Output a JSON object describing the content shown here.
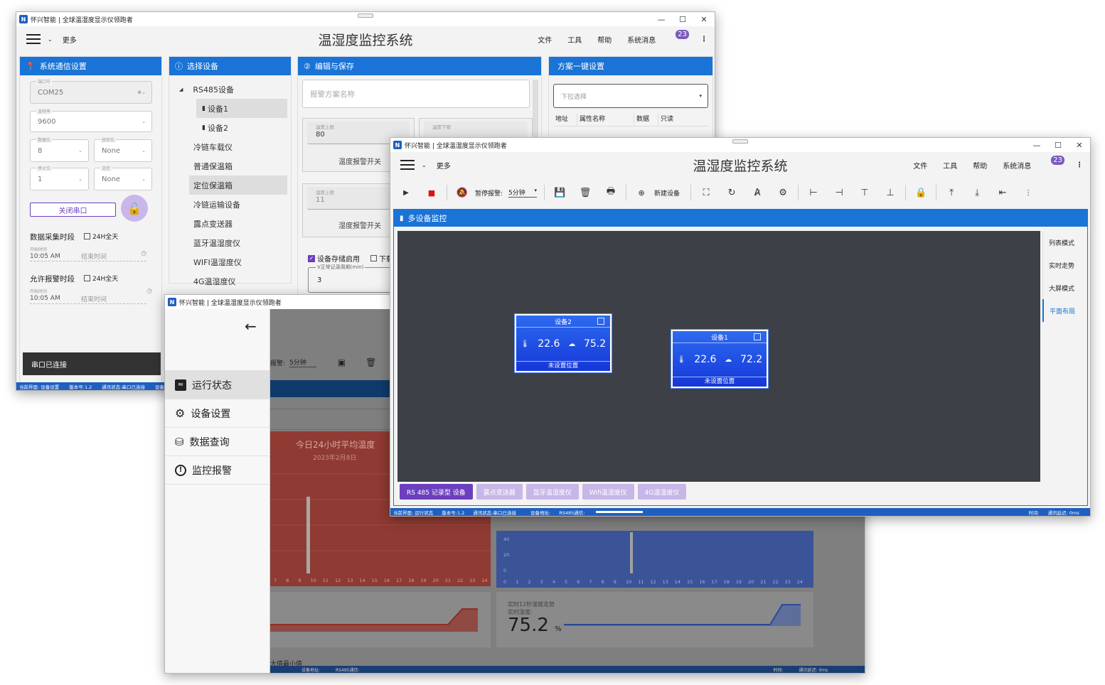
{
  "app": {
    "window_title": "怀兴智能 | 全球温湿度显示仪领跑者",
    "app_title": "温湿度监控系统",
    "logo_letter": "N",
    "more": "更多",
    "menus": {
      "file": "文件",
      "tools": "工具",
      "help": "帮助",
      "messages": "系统消息",
      "badge": "23"
    },
    "colors": {
      "accent": "#1a73d6",
      "statusbar": "#1f5fbf",
      "purple": "#6c3fbf"
    }
  },
  "win1": {
    "comm": {
      "header": "系统通信设置",
      "port_label": "端口号",
      "port_value": "COM25",
      "baud_label": "波特率",
      "baud_value": "9600",
      "databits_label": "数据位",
      "databits_value": "8",
      "parity_label": "校验位",
      "parity_value": "None",
      "stopbits_label": "停止位",
      "stopbits_value": "1",
      "flow_label": "流控",
      "flow_value": "None",
      "close_port": "关闭串口",
      "collect_period": "数据采集时段",
      "all_day": "24H全天",
      "start_label": "开始时间",
      "start_value": "10:05 AM",
      "end_placeholder": "结束时间",
      "alarm_period": "允许报警时段",
      "alarm_start_value": "10:05 AM",
      "toast": "串口已连接"
    },
    "select": {
      "header": "选择设备",
      "group": "RS485设备",
      "items": [
        "设备1",
        "设备2",
        "冷链车载仪",
        "普通保温箱",
        "定位保温箱",
        "冷链运输设备",
        "露点变送器",
        "蓝牙温湿度仪",
        "WIFI温湿度仪",
        "4G温湿度仪"
      ]
    },
    "edit": {
      "header": "编辑与保存",
      "scheme_placeholder": "报警方案名称",
      "temp_upper_label": "温度上限",
      "temp_upper_value": "80",
      "temp_lower_label": "温度下限",
      "temp_switch": "温度报警开关",
      "hum_upper_label": "湿度上限",
      "hum_upper_value": "11",
      "hum_switch": "湿度报警开关",
      "storage_enable": "设备存储启用",
      "download": "下载",
      "record_period_label": "V正常记录周期(min)",
      "record_period_value": "3"
    },
    "scheme": {
      "header": "方案一键设置",
      "dropdown": "下拉选择",
      "cols": [
        "地址",
        "属性名称",
        "数据",
        "只读"
      ]
    },
    "status": [
      "当前界面: 设备设置",
      "版本号:1.2",
      "通讯状态:串口已连接",
      "设备"
    ]
  },
  "win2": {
    "nav": [
      {
        "label": "运行状态",
        "icon": "wave-icon"
      },
      {
        "label": "设备设置",
        "icon": "gear-icon"
      },
      {
        "label": "数据查询",
        "icon": "db-search-icon"
      },
      {
        "label": "监控报警",
        "icon": "alert-icon"
      }
    ],
    "bg": {
      "pause_alarm_short": "报警:",
      "interval": "5分钟",
      "chart_title": "今日24小时平均温度",
      "chart_date": "2023年2月8日",
      "x_ticks_left": [
        "7",
        "8",
        "9",
        "10",
        "11",
        "12",
        "13",
        "14",
        "15",
        "16",
        "17",
        "18",
        "19",
        "20",
        "21",
        "22",
        "23",
        "24"
      ],
      "x_ticks_right": [
        "0",
        "1",
        "2",
        "3",
        "4",
        "5",
        "6",
        "7",
        "8",
        "9",
        "10",
        "11",
        "12",
        "13",
        "14",
        "15",
        "16",
        "17",
        "18",
        "19",
        "20",
        "21",
        "22",
        "23",
        "24"
      ],
      "y_ticks_right": [
        "40",
        "20",
        "0"
      ],
      "hum_trend_label": "实时12秒湿度走势",
      "hum_current_label": "实时湿度:",
      "hum_value": "75.2",
      "hum_unit": "%",
      "maxmin": "大值最小值",
      "status": [
        "设备地址:",
        "RS485通信:",
        "时间:",
        "通讯延迟: 0ms"
      ]
    }
  },
  "win3": {
    "toolbar": {
      "pause_alarm": "暂停报警:",
      "interval": "5分钟",
      "new_device": "新建设备"
    },
    "monitor": {
      "header": "多设备监控",
      "side_tabs": [
        "列表模式",
        "实时走势",
        "大屏模式",
        "平面布局"
      ],
      "active_side": "平面布局",
      "cards": [
        {
          "name": "设备2",
          "temp": "22.6",
          "hum": "75.2",
          "location": "未设置位置"
        },
        {
          "name": "设备1",
          "temp": "22.6",
          "hum": "72.2",
          "location": "未设置位置"
        }
      ],
      "bottom_tabs": [
        "RS 485 记录型 设备",
        "露点变送器",
        "蓝牙温湿度仪",
        "Wifi温湿度仪",
        "4G温湿度仪"
      ]
    },
    "status": [
      "当前界面: 运行状态",
      "版本号:1.2",
      "通讯状态:串口已连接",
      "设备地址:",
      "RS485通信:",
      "时间:",
      "通讯延迟: 0ms"
    ]
  }
}
